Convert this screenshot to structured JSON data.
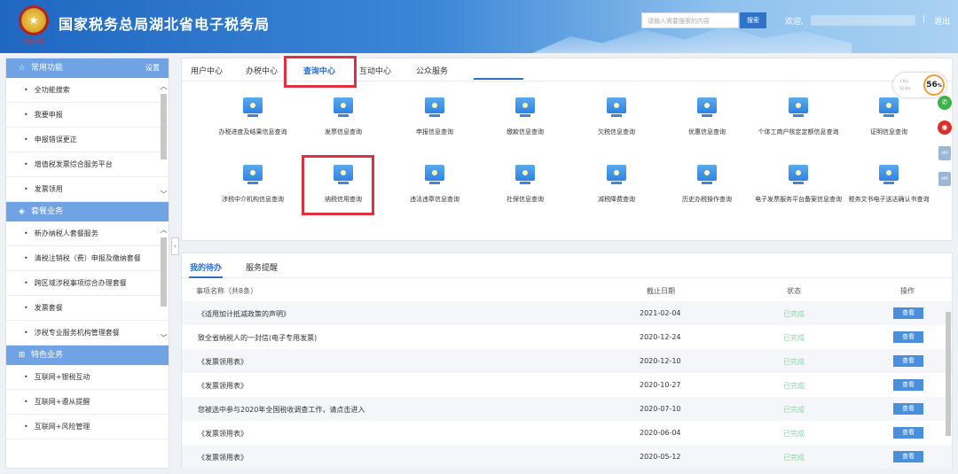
{
  "header": {
    "title": "国家税务总局湖北省电子税务局",
    "logo_text": "中国税务",
    "search_placeholder": "请输入需要搜索的内容",
    "search_button": "搜索",
    "welcome": "欢迎,",
    "separator": "|",
    "logout": "退出"
  },
  "sidebar": {
    "common": {
      "title": "常用功能",
      "settings": "设置",
      "icon": "star-icon",
      "items": [
        "全功能搜索",
        "我要申报",
        "申报错误更正",
        "增值税发票综合服务平台",
        "发票领用"
      ]
    },
    "package": {
      "title": "套餐业务",
      "icon": "layers-icon",
      "items": [
        "新办纳税人套餐服务",
        "清税注销税（费）申报及缴纳套餐",
        "跨区域涉税事项综合办理套餐",
        "发票套餐",
        "涉税专业服务机构管理套餐"
      ]
    },
    "special": {
      "title": "特色业务",
      "icon": "grid-icon",
      "items": [
        "互联网+银税互动",
        "互联网+遵从提醒",
        "互联网+风险管理"
      ]
    }
  },
  "top_tabs": [
    "用户中心",
    "办税中心",
    "查询中心",
    "互动中心",
    "公众服务"
  ],
  "active_tab": "查询中心",
  "services_row1": [
    "办税进度及结果信息查询",
    "发票信息查询",
    "申报信息查询",
    "缴款信息查询",
    "欠税信息查询",
    "优惠信息查询",
    "个体工商户核定定额信息查询",
    "证明信息查询"
  ],
  "services_row2": [
    "涉税中介机构信息查询",
    "纳税信用查询",
    "违法违章信息查询",
    "社保信息查询",
    "减税降费查询",
    "历史办税操作查询",
    "电子发票服务平台备案信息查询",
    "税务文书电子送达确认书查询"
  ],
  "bottom_tabs": [
    "我的待办",
    "服务提醒"
  ],
  "table": {
    "headers": [
      "事项名称（共8条）",
      "截止日期",
      "状态",
      "操作"
    ],
    "rows": [
      {
        "name": "《适用加计抵减政策的声明》",
        "date": "2021-02-04",
        "status": "已完成",
        "action": "查看"
      },
      {
        "name": "致全省纳税人的一封信(电子专用发票)",
        "date": "2020-12-24",
        "status": "已完成",
        "action": "查看"
      },
      {
        "name": "《发票领用表》",
        "date": "2020-12-10",
        "status": "已完成",
        "action": "查看"
      },
      {
        "name": "《发票领用表》",
        "date": "2020-10-27",
        "status": "已完成",
        "action": "查看"
      },
      {
        "name": "您被选中参与2020年全国税收调查工作，请点击进入",
        "date": "2020-07-10",
        "status": "已完成",
        "action": "查看"
      },
      {
        "name": "《发票领用表》",
        "date": "2020-06-04",
        "status": "已完成",
        "action": "查看"
      },
      {
        "name": "《发票领用表》",
        "date": "2020-05-12",
        "status": "已完成",
        "action": "查看"
      }
    ]
  },
  "widget": {
    "up": "1 K/s",
    "down": "12 K/s",
    "percent": "56",
    "percent_unit": "%"
  },
  "colors": {
    "accent": "#2c6fc7",
    "highlight": "#e03040",
    "done": "#8fd6a8"
  }
}
